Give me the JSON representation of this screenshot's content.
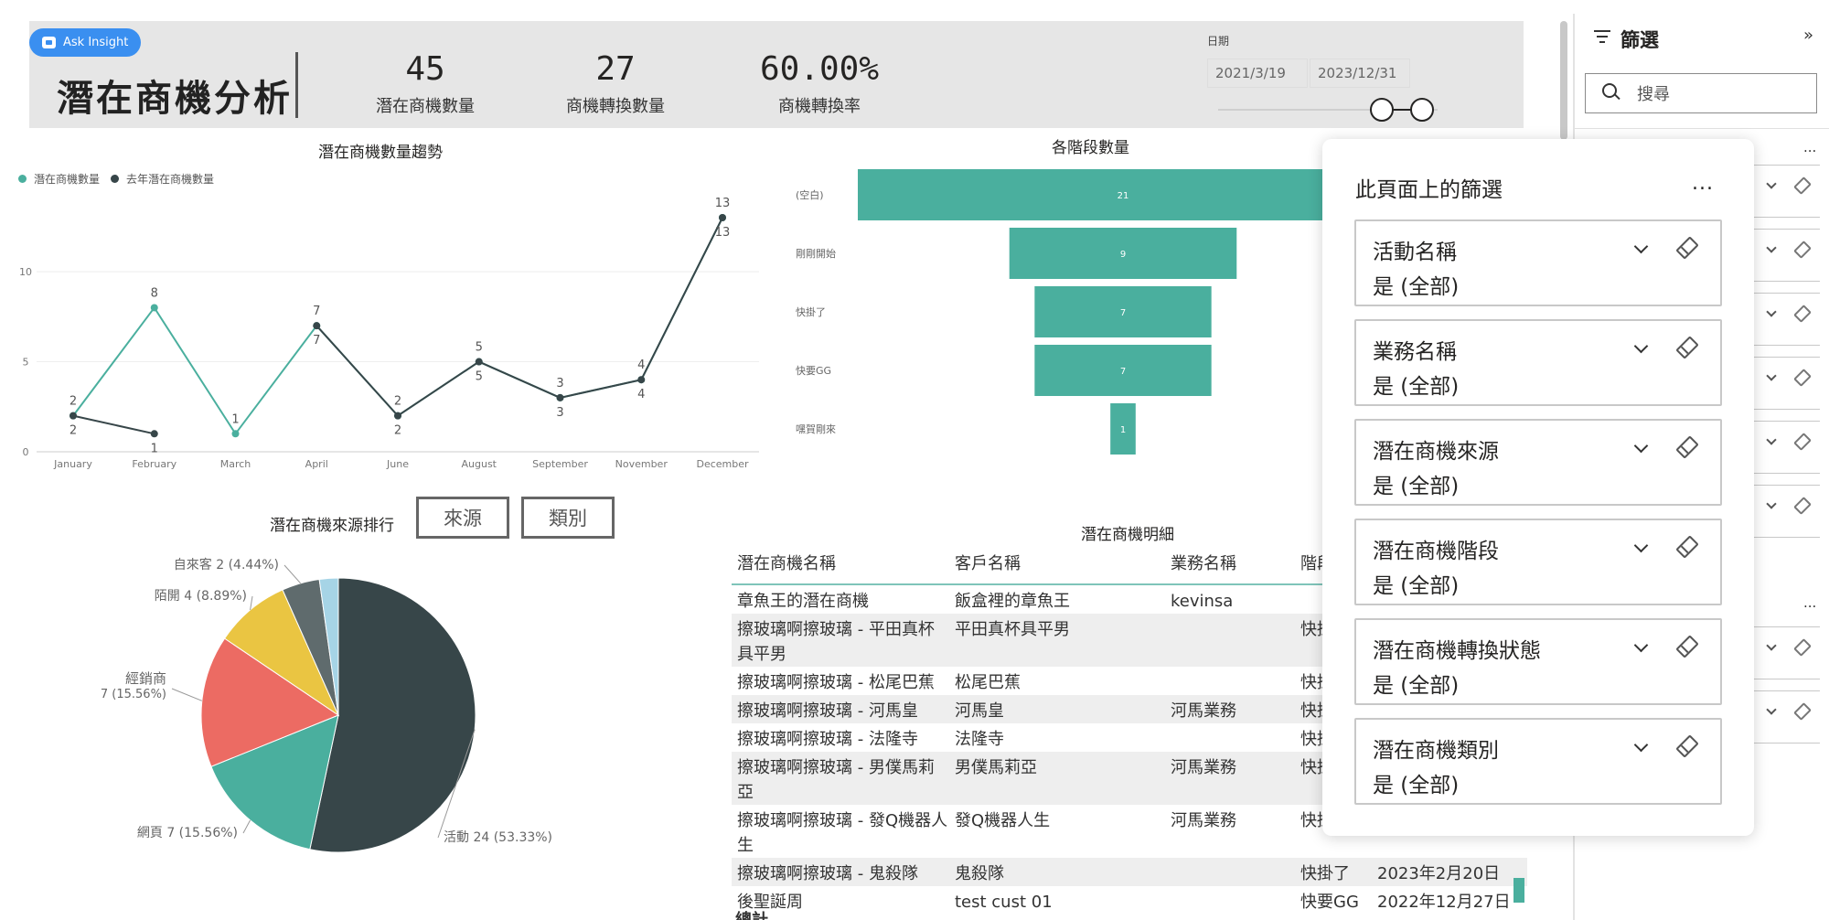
{
  "header": {
    "ask_insight": "Ask Insight",
    "title": "潛在商機分析",
    "kpis": [
      {
        "value": "45",
        "label": "潛在商機數量"
      },
      {
        "value": "27",
        "label": "商機轉換數量"
      },
      {
        "value": "60.00%",
        "label": "商機轉換率"
      }
    ],
    "date_filter": {
      "label": "日期",
      "start": "2021/3/19",
      "end": "2023/12/31"
    }
  },
  "trend": {
    "title": "潛在商機數量趨勢",
    "legend": [
      "潛在商機數量",
      "去年潛在商機數量"
    ]
  },
  "stages": {
    "title": "各階段數量"
  },
  "source_rank": {
    "title": "潛在商機來源排行",
    "btn_source": "來源",
    "btn_category": "類別"
  },
  "detail_table": {
    "title": "潛在商機明細",
    "columns": [
      "潛在商機名稱",
      "客戶名稱",
      "業務名稱",
      "階段"
    ],
    "rows": [
      {
        "name": "章魚王的潛在商機",
        "customer": "飯盒裡的章魚王",
        "sales": "kevinsa",
        "stage": "",
        "date": ""
      },
      {
        "name": "擦玻璃啊擦玻璃 - 平田真杯具平男",
        "customer": "平田真杯具平男",
        "sales": "",
        "stage": "快掛了",
        "date": ""
      },
      {
        "name": "擦玻璃啊擦玻璃 - 松尾巴蕉",
        "customer": "松尾巴蕉",
        "sales": "",
        "stage": "快掛了",
        "date": ""
      },
      {
        "name": "擦玻璃啊擦玻璃 - 河馬皇",
        "customer": "河馬皇",
        "sales": "河馬業務",
        "stage": "快掛了",
        "date": ""
      },
      {
        "name": "擦玻璃啊擦玻璃 - 法隆寺",
        "customer": "法隆寺",
        "sales": "",
        "stage": "快掛了",
        "date": ""
      },
      {
        "name": "擦玻璃啊擦玻璃 - 男僕馬莉亞",
        "customer": "男僕馬莉亞",
        "sales": "河馬業務",
        "stage": "快掛了",
        "date": ""
      },
      {
        "name": "擦玻璃啊擦玻璃 - 發Q機器人生",
        "customer": "發Q機器人生",
        "sales": "河馬業務",
        "stage": "快掛了",
        "date": ""
      },
      {
        "name": "擦玻璃啊擦玻璃 - 鬼殺隊",
        "customer": "鬼殺隊",
        "sales": "",
        "stage": "快掛了",
        "date": "2023年2月20日"
      },
      {
        "name": "後聖誕周",
        "customer": "test cust 01",
        "sales": "",
        "stage": "快要GG",
        "date": "2022年12月27日"
      }
    ],
    "total_label": "總計"
  },
  "filter_pane": {
    "title": "篩選",
    "search_placeholder": "搜尋",
    "page_filters_title": "此頁面上的篩選",
    "more": "...",
    "filters": [
      {
        "name": "活動名稱",
        "value": "是 (全部)"
      },
      {
        "name": "業務名稱",
        "value": "是 (全部)"
      },
      {
        "name": "潛在商機來源",
        "value": "是 (全部)"
      },
      {
        "name": "潛在商機階段",
        "value": "是 (全部)"
      },
      {
        "name": "潛在商機轉換狀態",
        "value": "是 (全部)"
      },
      {
        "name": "潛在商機類別",
        "value": "是 (全部)"
      }
    ]
  },
  "colors": {
    "teal": "#4aaf9e",
    "dark": "#374649",
    "gray": "#5f6b6d",
    "red": "#ec6b63",
    "yellow": "#eac542",
    "lightblue": "#a6d4e6"
  },
  "chart_data": [
    {
      "type": "line",
      "x": [
        "January",
        "February",
        "March",
        "April",
        "June",
        "August",
        "September",
        "November",
        "December"
      ],
      "yticks": [
        0,
        5,
        10
      ],
      "ylim": [
        0,
        13
      ],
      "series": [
        {
          "name": "潛在商機數量",
          "values": [
            2,
            8,
            1,
            7,
            2,
            5,
            3,
            4,
            13
          ]
        },
        {
          "name": "去年潛在商機數量",
          "values": [
            2,
            1,
            null,
            7,
            2,
            5,
            3,
            4,
            13
          ]
        }
      ]
    },
    {
      "type": "bar",
      "orientation": "funnel",
      "categories": [
        "(空白)",
        "剛剛開始",
        "快掛了",
        "快要GG",
        "嘿賀剛來"
      ],
      "values": [
        21,
        9,
        7,
        7,
        1
      ]
    },
    {
      "type": "pie",
      "slices": [
        {
          "label": "活動",
          "value": 24,
          "pct": "53.33%",
          "color": "#374649"
        },
        {
          "label": "網頁",
          "value": 7,
          "pct": "15.56%",
          "color": "#4aaf9e"
        },
        {
          "label": "經銷商",
          "value": 7,
          "pct": "15.56%",
          "color": "#ec6b63"
        },
        {
          "label": "陌開",
          "value": 4,
          "pct": "8.89%",
          "color": "#eac542"
        },
        {
          "label": "自來客",
          "value": 2,
          "pct": "4.44%",
          "color": "#5f6b6d"
        },
        {
          "label": "",
          "value": 1,
          "pct": "",
          "color": "#a6d4e6"
        }
      ]
    }
  ]
}
